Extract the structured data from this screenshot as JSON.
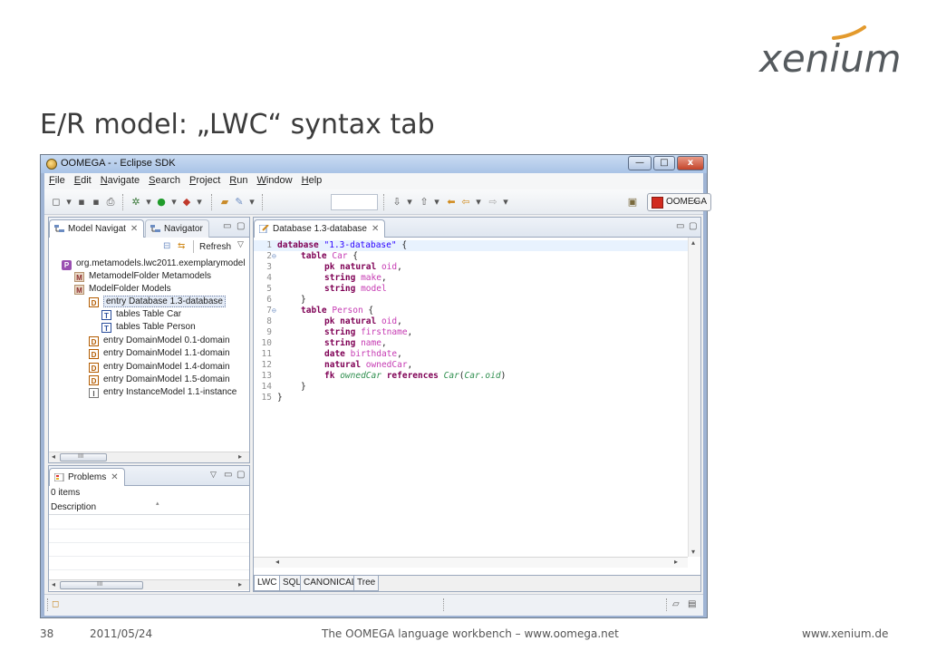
{
  "slide": {
    "logo": "xenium",
    "title": "E/R model: „LWC“ syntax tab",
    "footer": {
      "page": "38",
      "date": "2011/05/24",
      "center": "The OOMEGA language workbench – www.oomega.net",
      "right": "www.xenium.de"
    }
  },
  "window": {
    "title": "OOMEGA - - Eclipse SDK",
    "controls": {
      "minimize": "—",
      "maximize": "□",
      "close": "x"
    },
    "menu": [
      "File",
      "Edit",
      "Navigate",
      "Search",
      "Project",
      "Run",
      "Window",
      "Help"
    ],
    "perspective": "OOMEGA"
  },
  "left_panel": {
    "tabs": [
      {
        "label": "Model Navigat",
        "close": "✕"
      },
      {
        "label": "Navigator"
      }
    ],
    "refresh_label": "Refresh",
    "tree": [
      {
        "label": "org.metamodels.lwc2011.exemplarymodel",
        "icon": "project-icon"
      },
      {
        "label": "MetamodelFolder Metamodels",
        "icon": "m-folder-icon"
      },
      {
        "label": "ModelFolder Models",
        "icon": "m-folder-icon"
      },
      {
        "label": "entry Database 1.3-database",
        "icon": "d-entry-icon"
      },
      {
        "label": "tables Table Car",
        "icon": "t-table-icon"
      },
      {
        "label": "tables Table Person",
        "icon": "t-table-icon"
      },
      {
        "label": "entry DomainModel 0.1-domain",
        "icon": "d-entry-icon"
      },
      {
        "label": "entry DomainModel 1.1-domain",
        "icon": "d-entry-icon"
      },
      {
        "label": "entry DomainModel 1.4-domain",
        "icon": "d-entry-icon"
      },
      {
        "label": "entry DomainModel 1.5-domain",
        "icon": "d-entry-icon"
      },
      {
        "label": "entry InstanceModel 1.1-instance",
        "icon": "i-entry-icon"
      }
    ],
    "scroll_grip": "III"
  },
  "problems_panel": {
    "tab_label": "Problems",
    "close": "✕",
    "count": "0 items",
    "column": "Description",
    "scroll_grip": "III"
  },
  "editor": {
    "tab_label": "Database 1.3-database",
    "close": "✕",
    "lines": [
      {
        "n": "1",
        "marker": ""
      },
      {
        "n": "2",
        "marker": "⊖"
      },
      {
        "n": "3",
        "marker": ""
      },
      {
        "n": "4",
        "marker": ""
      },
      {
        "n": "5",
        "marker": ""
      },
      {
        "n": "6",
        "marker": ""
      },
      {
        "n": "7",
        "marker": "⊖"
      },
      {
        "n": "8",
        "marker": ""
      },
      {
        "n": "9",
        "marker": ""
      },
      {
        "n": "10",
        "marker": ""
      },
      {
        "n": "11",
        "marker": ""
      },
      {
        "n": "12",
        "marker": ""
      },
      {
        "n": "13",
        "marker": ""
      },
      {
        "n": "14",
        "marker": ""
      },
      {
        "n": "15",
        "marker": ""
      }
    ],
    "code": {
      "l1": [
        "database",
        "\"1.3-database\"",
        "{"
      ],
      "l2": [
        "table",
        "Car",
        "{"
      ],
      "l3": [
        "pk natural",
        "oid",
        ","
      ],
      "l4": [
        "string",
        "make",
        ","
      ],
      "l5": [
        "string",
        "model"
      ],
      "l6": [
        "}"
      ],
      "l7": [
        "table",
        "Person",
        "{"
      ],
      "l8": [
        "pk natural",
        "oid",
        ","
      ],
      "l9": [
        "string",
        "firstname",
        ","
      ],
      "l10": [
        "string",
        "name",
        ","
      ],
      "l11": [
        "date",
        "birthdate",
        ","
      ],
      "l12": [
        "natural",
        "ownedCar",
        ","
      ],
      "l13": [
        "fk",
        "ownedCar",
        "references",
        "Car",
        "(",
        "Car.oid",
        ")"
      ],
      "l14": [
        "}"
      ],
      "l15": [
        "}"
      ]
    },
    "bottom_tabs": [
      "LWC",
      "SQL",
      "CANONICAL",
      "Tree"
    ]
  }
}
